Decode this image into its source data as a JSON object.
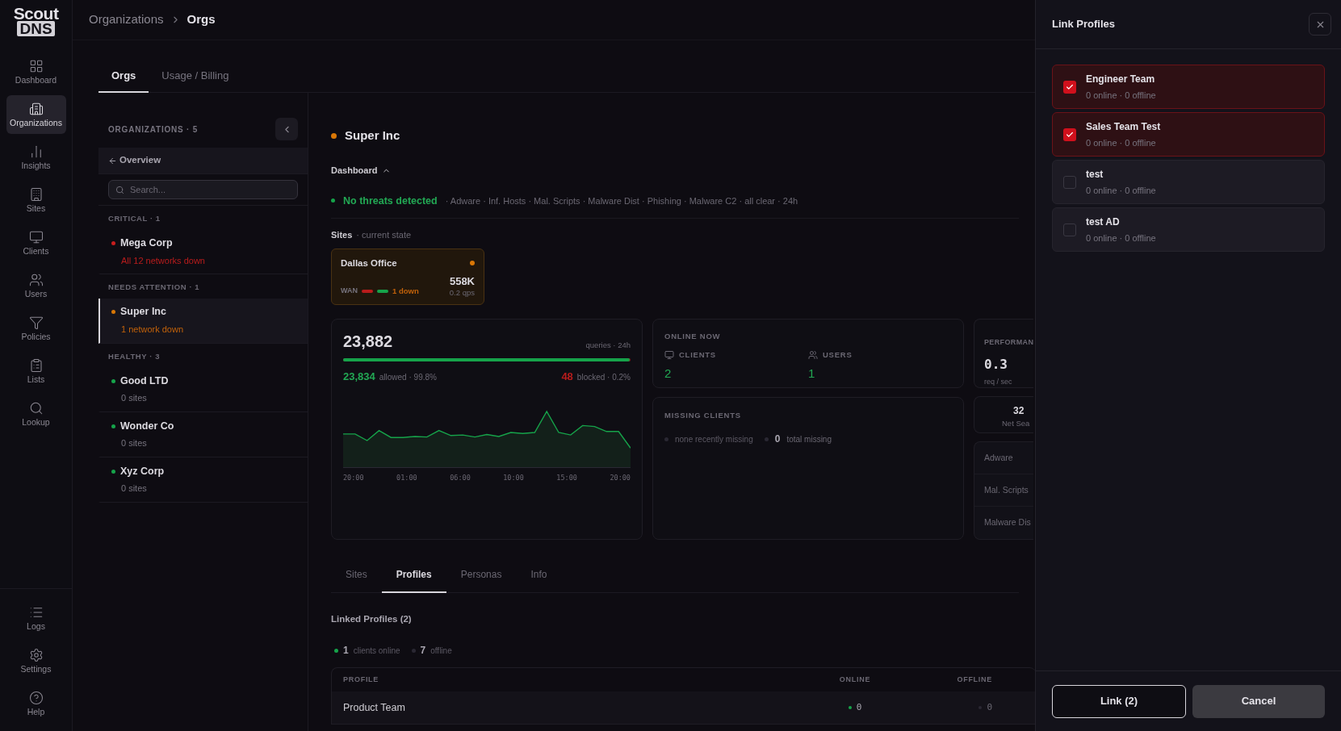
{
  "logo": {
    "line1": "Scout",
    "line2": "DNS"
  },
  "sidebar": {
    "items": [
      {
        "label": "Dashboard",
        "kind": "grid",
        "selected": false
      },
      {
        "label": "Organizations",
        "kind": "building",
        "selected": true
      },
      {
        "label": "Insights",
        "kind": "bars",
        "selected": false
      },
      {
        "label": "Sites",
        "kind": "office",
        "selected": false
      },
      {
        "label": "Clients",
        "kind": "monitor",
        "selected": false
      },
      {
        "label": "Users",
        "kind": "users",
        "selected": false
      },
      {
        "label": "Policies",
        "kind": "filter",
        "selected": false
      },
      {
        "label": "Lists",
        "kind": "clipboard",
        "selected": false
      },
      {
        "label": "Lookup",
        "kind": "search",
        "selected": false
      }
    ],
    "bottom_items": [
      {
        "label": "Logs",
        "kind": "list",
        "selected": false
      },
      {
        "label": "Settings",
        "kind": "settings",
        "selected": false
      },
      {
        "label": "Help",
        "kind": "help",
        "selected": false
      }
    ]
  },
  "breadcrumb": [
    "Organizations",
    "Orgs"
  ],
  "tabs": [
    {
      "label": "Orgs",
      "selected": true
    },
    {
      "label": "Usage / Billing",
      "selected": false
    }
  ],
  "org_panel": {
    "title": "ORGANIZATIONS · 5",
    "back_link": "Overview",
    "search": {
      "placeholder": "Search..."
    },
    "groups": [
      {
        "label": "CRITICAL · 1",
        "orgs": [
          {
            "name": "Mega Corp",
            "status": "All 12 networks down",
            "kind": "critical",
            "color": "#c81e1e",
            "selected": false
          }
        ]
      },
      {
        "label": "NEEDS ATTENTION · 1",
        "orgs": [
          {
            "name": "Super Inc",
            "status": "1 network down",
            "kind": "warning",
            "color": "#d97706",
            "selected": true
          }
        ]
      },
      {
        "label": "HEALTHY · 3",
        "orgs": [
          {
            "name": "Good LTD",
            "status": "0 sites",
            "kind": "healthy",
            "color": "#16a34a",
            "selected": false
          },
          {
            "name": "Wonder Co",
            "status": "0 sites",
            "kind": "healthy",
            "color": "#16a34a",
            "selected": false
          },
          {
            "name": "Xyz Corp",
            "status": "0 sites",
            "kind": "healthy",
            "color": "#16a34a",
            "selected": false
          }
        ]
      }
    ]
  },
  "detail": {
    "title": "Super Inc",
    "color": "#d97706",
    "dashboard": {
      "label": "Dashboard",
      "expanded": true
    },
    "threats": {
      "headline": "No threats detected",
      "details": "· Adware · Inf. Hosts · Mal. Scripts · Malware Dist · Phishing · Malware C2 · all clear · 24h"
    },
    "sites": {
      "title": "Sites",
      "subtitle": "· current state",
      "cards": [
        {
          "name": "Dallas Office",
          "color": "#d97706",
          "queries": "558K",
          "rate": "0.2 qps",
          "wan_label": "WAN",
          "links": [
            {
              "color": "#b91c1c"
            },
            {
              "color": "#16a34a"
            }
          ],
          "wan_status": "1 down"
        }
      ]
    },
    "queries": {
      "total": "23,882",
      "caption": "queries · 24h",
      "level": 0.998,
      "allowed": "23,834",
      "allowed_caption": "allowed · 99.8%",
      "blocked": "48",
      "blocked_caption": "blocked · 0.2%",
      "x_labels": [
        "20:00",
        "01:00",
        "06:00",
        "10:00",
        "15:00",
        "20:00"
      ]
    },
    "online_now": {
      "title": "ONLINE NOW",
      "stats": [
        {
          "kind": "monitor",
          "label": "CLIENTS",
          "value": "2"
        },
        {
          "kind": "users",
          "label": "USERS",
          "value": "1"
        }
      ]
    },
    "missing_clients": {
      "title": "MISSING CLIENTS",
      "recent": "none recently missing",
      "total": "0",
      "total_caption": "total missing"
    },
    "performance": {
      "title": "PERFORMAN",
      "value": "0.3",
      "unit": "req / sec"
    },
    "net": {
      "value": "32",
      "label": "Net Sea"
    },
    "threat_list": [
      "Adware",
      "Mal. Scripts",
      "Malware Dis"
    ],
    "bottom_tabs": [
      {
        "label": "Sites",
        "selected": false
      },
      {
        "label": "Profiles",
        "selected": true
      },
      {
        "label": "Personas",
        "selected": false
      },
      {
        "label": "Info",
        "selected": false
      }
    ],
    "linked": {
      "title": "Linked Profiles (2)",
      "online": "1",
      "online_caption": "clients online",
      "offline": "7",
      "offline_caption": "offline"
    },
    "table": {
      "columns": [
        "PROFILE",
        "ONLINE",
        "OFFLINE"
      ],
      "rows": [
        {
          "profile": "Product Team",
          "online": "0",
          "offline": "0"
        }
      ]
    }
  },
  "drawer": {
    "title": "Link Profiles",
    "profiles": [
      {
        "name": "Engineer Team",
        "summary": "0 online · 0 offline",
        "checked": true
      },
      {
        "name": "Sales Team Test",
        "summary": "0 online · 0 offline",
        "checked": true
      },
      {
        "name": "test",
        "summary": "0 online · 0 offline",
        "checked": false
      },
      {
        "name": "test AD",
        "summary": "0 online · 0 offline",
        "checked": false
      }
    ],
    "buttons": [
      {
        "label": "Link (2)",
        "kind": "primary"
      },
      {
        "label": "Cancel",
        "kind": "secondary"
      }
    ]
  }
}
